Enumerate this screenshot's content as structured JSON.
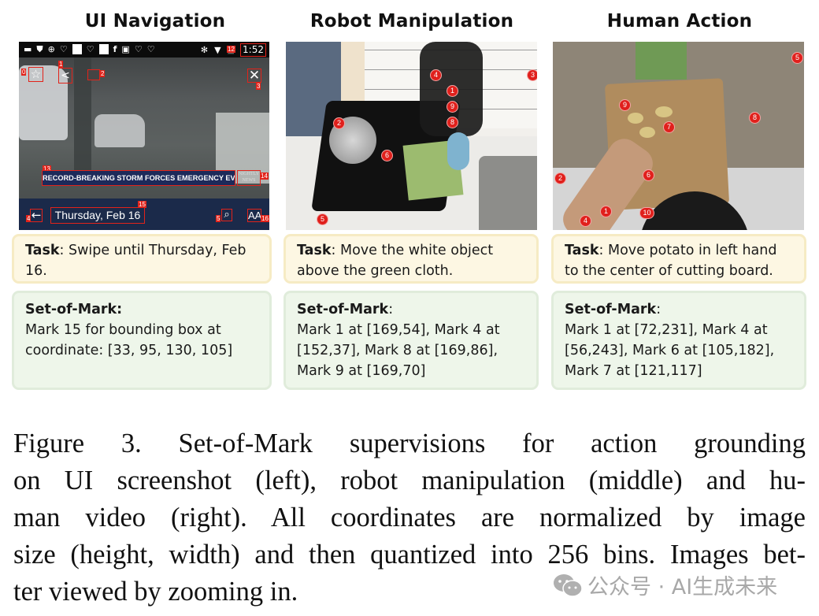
{
  "panels": [
    {
      "title": "UI Navigation",
      "task_label": "Task",
      "task_text": ": Swipe until Thursday, Feb 16.",
      "som_label": "Set-of-Mark:",
      "som_text": "Mark 15 for bounding box at coordinate: [33, 95, 130, 105]",
      "screenshot": {
        "status_time": "1:52",
        "headline": "RECORD-BREAKING STORM FORCES EMERGENCY EVACS",
        "logo": "NIGHTLY NEWS",
        "date_label": "Thursday, Feb 16",
        "font_button": "AA",
        "marks": [
          "0",
          "1",
          "2",
          "3",
          "4",
          "5",
          "12",
          "13",
          "14",
          "15",
          "16"
        ]
      }
    },
    {
      "title": "Robot Manipulation",
      "task_label": "Task",
      "task_text": ": Move the white object above the green cloth.",
      "som_label": "Set-of-Mark",
      "som_colon": ":",
      "som_text": "Mark 1 at [169,54], Mark 4 at [152,37], Mark 8 at [169,86], Mark 9 at [169,70]",
      "marks": [
        "1",
        "2",
        "3",
        "4",
        "5",
        "6",
        "8",
        "9"
      ]
    },
    {
      "title": "Human Action",
      "task_label": "Task",
      "task_text": ": Move potato in left hand to the center of cutting board.",
      "som_label": "Set-of-Mark",
      "som_colon": ":",
      "som_text": "Mark 1 at [72,231], Mark 4 at [56,243], Mark 6 at [105,182], Mark 7 at [121,117]",
      "marks": [
        "1",
        "2",
        "4",
        "5",
        "6",
        "7",
        "8",
        "9",
        "10"
      ]
    }
  ],
  "caption": {
    "lines": [
      "Figure 3.  Set-of-Mark supervisions for action grounding",
      "on UI screenshot (left), robot manipulation (middle) and hu-",
      "man video (right).  All coordinates are normalized by image",
      "size (height, width) and then quantized into 256 bins. Images bet-",
      "ter viewed by zooming in."
    ]
  },
  "watermark": {
    "icon": "wechat-icon",
    "text": "公众号 · AI生成未来"
  },
  "colors": {
    "mark_red": "#e0201c",
    "task_bg": "#fdf7e3",
    "som_bg": "#eef6ea",
    "ui_navbar": "#1b2a4a"
  }
}
